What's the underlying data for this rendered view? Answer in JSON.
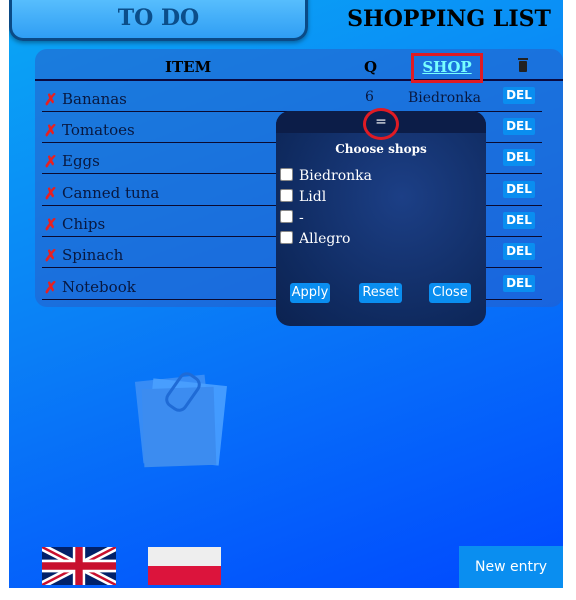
{
  "tabs": {
    "todo": "TO DO",
    "shopping": "SHOPPING LIST"
  },
  "table": {
    "headers": {
      "item": "ITEM",
      "quantity": "Q",
      "shop": "SHOP"
    },
    "rows": [
      {
        "name": "Bananas",
        "qty": "6",
        "shop": "Biedronka",
        "delete": "DEL"
      },
      {
        "name": "Tomatoes",
        "qty": "",
        "shop": "",
        "delete": "DEL"
      },
      {
        "name": "Eggs",
        "qty": "",
        "shop": "",
        "delete": "DEL"
      },
      {
        "name": "Canned tuna",
        "qty": "",
        "shop": "",
        "delete": "DEL"
      },
      {
        "name": "Chips",
        "qty": "",
        "shop": "",
        "delete": "DEL"
      },
      {
        "name": "Spinach",
        "qty": "",
        "shop": "",
        "delete": "DEL"
      },
      {
        "name": "Notebook",
        "qty": "",
        "shop": "",
        "delete": "DEL"
      }
    ],
    "remove_glyph": "✗"
  },
  "shop_filter": {
    "handle": "=",
    "title": "Choose shops",
    "options": [
      {
        "label": "Biedronka",
        "checked": false
      },
      {
        "label": "Lidl",
        "checked": false
      },
      {
        "label": "-",
        "checked": false
      },
      {
        "label": "Allegro",
        "checked": false
      }
    ],
    "apply": "Apply",
    "reset": "Reset",
    "close": "Close"
  },
  "footer": {
    "new_entry": "New entry"
  },
  "colors": {
    "accent": "#0a8ef0",
    "highlight": "#e01b24"
  },
  "icons": {
    "trash": "trash-icon",
    "remove": "cross-icon",
    "note": "sticky-notes-icon"
  }
}
